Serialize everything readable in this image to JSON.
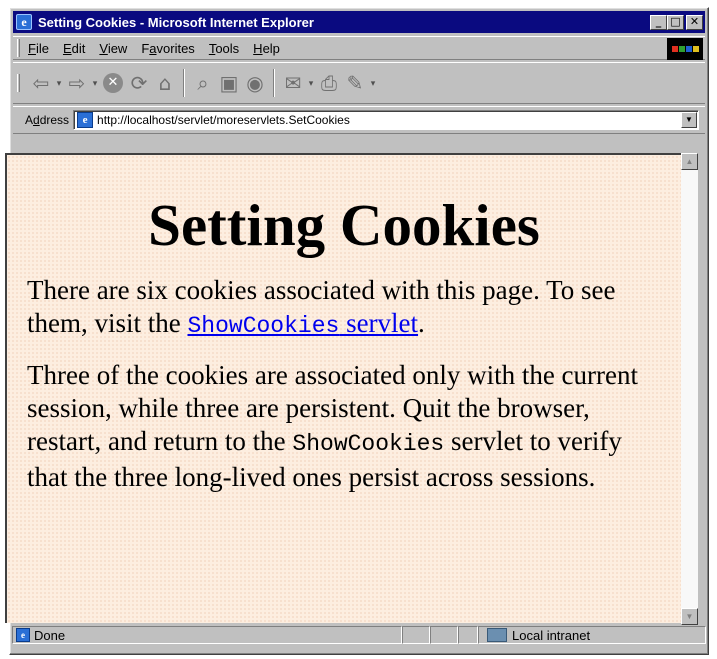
{
  "window": {
    "title": "Setting Cookies - Microsoft Internet Explorer",
    "buttons": {
      "minimize": "_",
      "maximize": "□",
      "close": "✕"
    }
  },
  "menu": [
    {
      "label": "File",
      "key": "F",
      "rest": "ile"
    },
    {
      "label": "Edit",
      "key": "E",
      "rest": "dit"
    },
    {
      "label": "View",
      "key": "V",
      "rest": "iew"
    },
    {
      "label": "Favorites",
      "pre": "F",
      "key": "a",
      "rest": "vorites"
    },
    {
      "label": "Tools",
      "key": "T",
      "rest": "ools"
    },
    {
      "label": "Help",
      "key": "H",
      "rest": "elp"
    }
  ],
  "toolbar": {
    "icons": [
      "back-icon",
      "forward-icon",
      "stop-icon",
      "refresh-icon",
      "home-icon",
      "search-icon",
      "favorites-icon",
      "history-icon",
      "mail-icon",
      "print-icon",
      "edit-icon"
    ],
    "back": "⇦",
    "forward": "⇨",
    "stop": "✕",
    "refresh": "⟳",
    "home": "⌂",
    "search": "⌕",
    "favorites": "▣",
    "history": "◉",
    "mail": "✉",
    "print": "⎙",
    "edit": "✎",
    "dropdown": "▾"
  },
  "address": {
    "label": "Address",
    "label_key": "d",
    "url": "http://localhost/servlet/moreservlets.SetCookies",
    "dropdown": "▼"
  },
  "page": {
    "heading": "Setting Cookies",
    "para1_before": "There are six cookies associated with this page. To see them, visit the ",
    "link_code": "ShowCookies",
    "link_text": " servlet",
    "para1_after": ".",
    "para2_before": "Three of the cookies are associated only with the current session, while three are persistent. Quit the browser, restart, and return to the ",
    "para2_code": "ShowCookies",
    "para2_after": " servlet to verify that the three long-lived ones persist across sessions."
  },
  "scrollbar": {
    "up": "▲",
    "down": "▼"
  },
  "status": {
    "text": "Done",
    "zone": "Local intranet"
  },
  "colors": {
    "titlebar": "#0a0a80",
    "chrome": "#c0c0c0",
    "page_background": "#fdeee0",
    "link": "#0000ee"
  }
}
